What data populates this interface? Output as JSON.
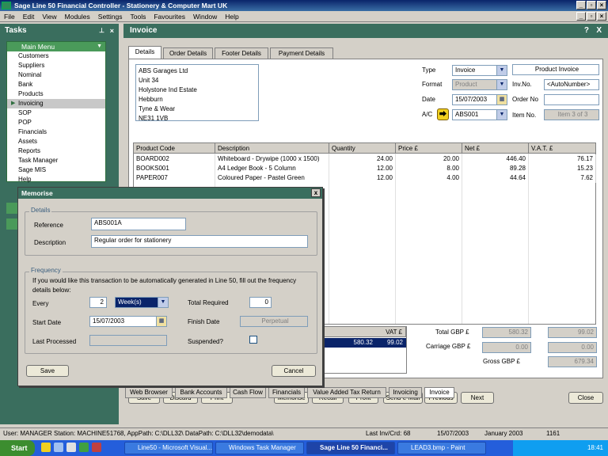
{
  "window": {
    "title": "Sage Line 50 Financial Controller - Stationery & Computer Mart UK"
  },
  "menu": [
    "File",
    "Edit",
    "View",
    "Modules",
    "Settings",
    "Tools",
    "Favourites",
    "Window",
    "Help"
  ],
  "tasks": {
    "title": "Tasks",
    "menu_title": "Main Menu",
    "items": [
      "Customers",
      "Suppliers",
      "Nominal",
      "Bank",
      "Products",
      "Invoicing",
      "SOP",
      "POP",
      "Financials",
      "Assets",
      "Reports",
      "Task Manager",
      "Sage MIS",
      "Help"
    ],
    "selected": "Invoicing"
  },
  "invoice": {
    "title": "Invoice",
    "help_btn": "?",
    "close_btn": "X",
    "tabs": [
      "Details",
      "Order Details",
      "Footer Details",
      "Payment Details"
    ],
    "address": [
      "ABS Garages Ltd",
      "Unit 34",
      "Holystone Ind Estate",
      "Hebburn",
      "Tyne & Wear",
      "NE31 1VB"
    ],
    "type_label": "Type",
    "type_value": "Invoice",
    "format_label": "Format",
    "format_value": "Product",
    "date_label": "Date",
    "date_value": "15/07/2003",
    "ac_label": "A/C",
    "ac_value": "ABS001",
    "product_invoice": "Product Invoice",
    "invno_label": "Inv.No.",
    "invno_value": "<AutoNumber>",
    "orderno_label": "Order No",
    "orderno_value": "",
    "itemno_label": "Item No.",
    "itemno_value": "Item 3 of 3",
    "grid_headers": [
      "Product Code",
      "Description",
      "Quantity",
      "Price £",
      "Net £",
      "V.A.T. £"
    ],
    "rows": [
      [
        "BOARD002",
        "Whiteboard - Drywipe (1000 x 1500)",
        "24.00",
        "20.00",
        "446.40",
        "76.17"
      ],
      [
        "BOOKS001",
        "A4 Ledger Book - 5 Column",
        "12.00",
        "8.00",
        "89.28",
        "15.23"
      ],
      [
        "PAPER007",
        "Coloured Paper - Pastel Green",
        "12.00",
        "4.00",
        "44.64",
        "7.62"
      ]
    ],
    "summary_vat_header": "VAT £",
    "summary_row": [
      "580.32",
      "99.02"
    ],
    "total_gbp_label": "Total GBP £",
    "total_net": "580.32",
    "total_vat": "99.02",
    "carriage_label": "Carriage GBP £",
    "carriage_net": "0.00",
    "carriage_vat": "0.00",
    "gross_label": "Gross GBP £",
    "gross_value": "679.34",
    "buttons": [
      "Save",
      "Discard",
      "Print",
      "Memorise",
      "Recall",
      "Profit",
      "Send e-Mail",
      "Previous",
      "Next",
      "Close"
    ],
    "bottom_tabs": [
      "Web Browser",
      "Bank Accounts",
      "Cash Flow",
      "Financials",
      "Value Added Tax Return",
      "Invoicing",
      "Invoice"
    ]
  },
  "memorise": {
    "title": "Memorise",
    "close": "x",
    "details_group": "Details",
    "reference_label": "Reference",
    "reference_value": "ABS001A",
    "description_label": "Description",
    "description_value": "Regular order for stationery",
    "frequency_group": "Frequency",
    "frequency_text": "If you would like this transaction to be automatically generated in Line 50, fill out the frequency details below:",
    "every_label": "Every",
    "every_value": "2",
    "every_unit": "Week(s)",
    "total_required_label": "Total Required",
    "total_required_value": "0",
    "start_date_label": "Start Date",
    "start_date_value": "15/07/2003",
    "finish_date_label": "Finish Date",
    "finish_date_value": "Perpetual",
    "last_processed_label": "Last Processed",
    "last_processed_value": "",
    "suspended_label": "Suspended?",
    "save": "Save",
    "cancel": "Cancel"
  },
  "statusbar": {
    "left": "User: MANAGER Station: MACHINE51768, AppPath: C:\\DLL32\\ DataPath: C:\\DLL32\\demodata\\",
    "last_inv": "Last Inv/Crd: 68",
    "date": "15/07/2003",
    "period": "January 2003",
    "code": "1161"
  },
  "taskbar": {
    "start": "Start",
    "items": [
      "Line50 - Microsoft Visual...",
      "Windows Task Manager",
      "Sage Line 50 Financi...",
      "LEAD3.bmp - Paint"
    ],
    "active": "Sage Line 50 Financi...",
    "clock": "18:41"
  }
}
